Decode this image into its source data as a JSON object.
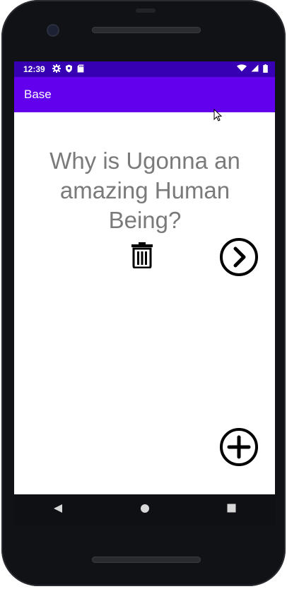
{
  "status_bar": {
    "time": "12:39",
    "icons": [
      "gear-icon",
      "shield-icon",
      "sd-card-icon",
      "wifi-icon",
      "signal-icon",
      "battery-icon"
    ]
  },
  "app_bar": {
    "title": "Base"
  },
  "main": {
    "question": "Why is Ugonna an amazing Human Being?",
    "buttons": {
      "delete": "trash-icon",
      "next": "chevron-right-circle-icon",
      "add": "plus-circle-icon"
    }
  },
  "nav_bar": {
    "icons": [
      "back-triangle-icon",
      "home-circle-icon",
      "recents-square-icon"
    ]
  },
  "colors": {
    "status_bar": "#3700b3",
    "app_bar": "#6200ee",
    "question_text": "#7a7a7a"
  }
}
